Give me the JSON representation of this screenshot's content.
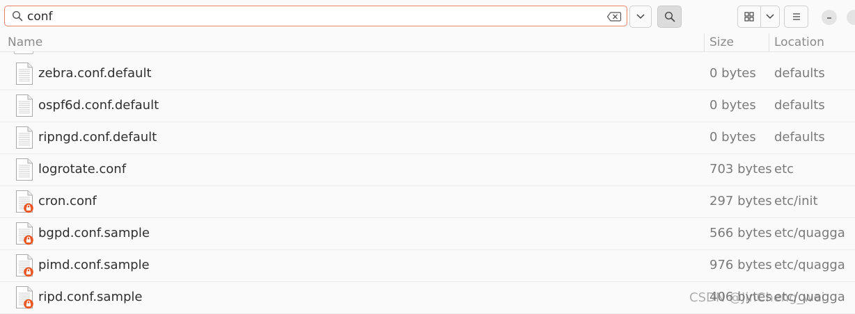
{
  "search": {
    "value": "conf",
    "placeholder": ""
  },
  "columns": {
    "name": "Name",
    "size": "Size",
    "location": "Location"
  },
  "icons": {
    "search": "search-icon",
    "clear": "backspace-clear-icon",
    "dropdown": "chevron-down-icon",
    "grid": "grid-view-icon",
    "menu": "hamburger-menu-icon",
    "minimize": "minimize-icon",
    "file": "text-file-icon",
    "lock": "lock-badge-icon"
  },
  "colors": {
    "accent": "#e9846b",
    "lock_badge": "#e95420"
  },
  "files": [
    {
      "name": "zebra.conf.default",
      "size": "0 bytes",
      "location": "defaults",
      "locked": false
    },
    {
      "name": "ospf6d.conf.default",
      "size": "0 bytes",
      "location": "defaults",
      "locked": false
    },
    {
      "name": "ripngd.conf.default",
      "size": "0 bytes",
      "location": "defaults",
      "locked": false
    },
    {
      "name": "logrotate.conf",
      "size": "703 bytes",
      "location": "etc",
      "locked": false
    },
    {
      "name": "cron.conf",
      "size": "297 bytes",
      "location": "etc/init",
      "locked": true
    },
    {
      "name": "bgpd.conf.sample",
      "size": "566 bytes",
      "location": "etc/quagga",
      "locked": true
    },
    {
      "name": "pimd.conf.sample",
      "size": "976 bytes",
      "location": "etc/quagga",
      "locked": true
    },
    {
      "name": "ripd.conf.sample",
      "size": "406 bytes",
      "location": "etc/quagga",
      "locked": true
    }
  ],
  "watermark": "CSDN @JinCheng_wei"
}
